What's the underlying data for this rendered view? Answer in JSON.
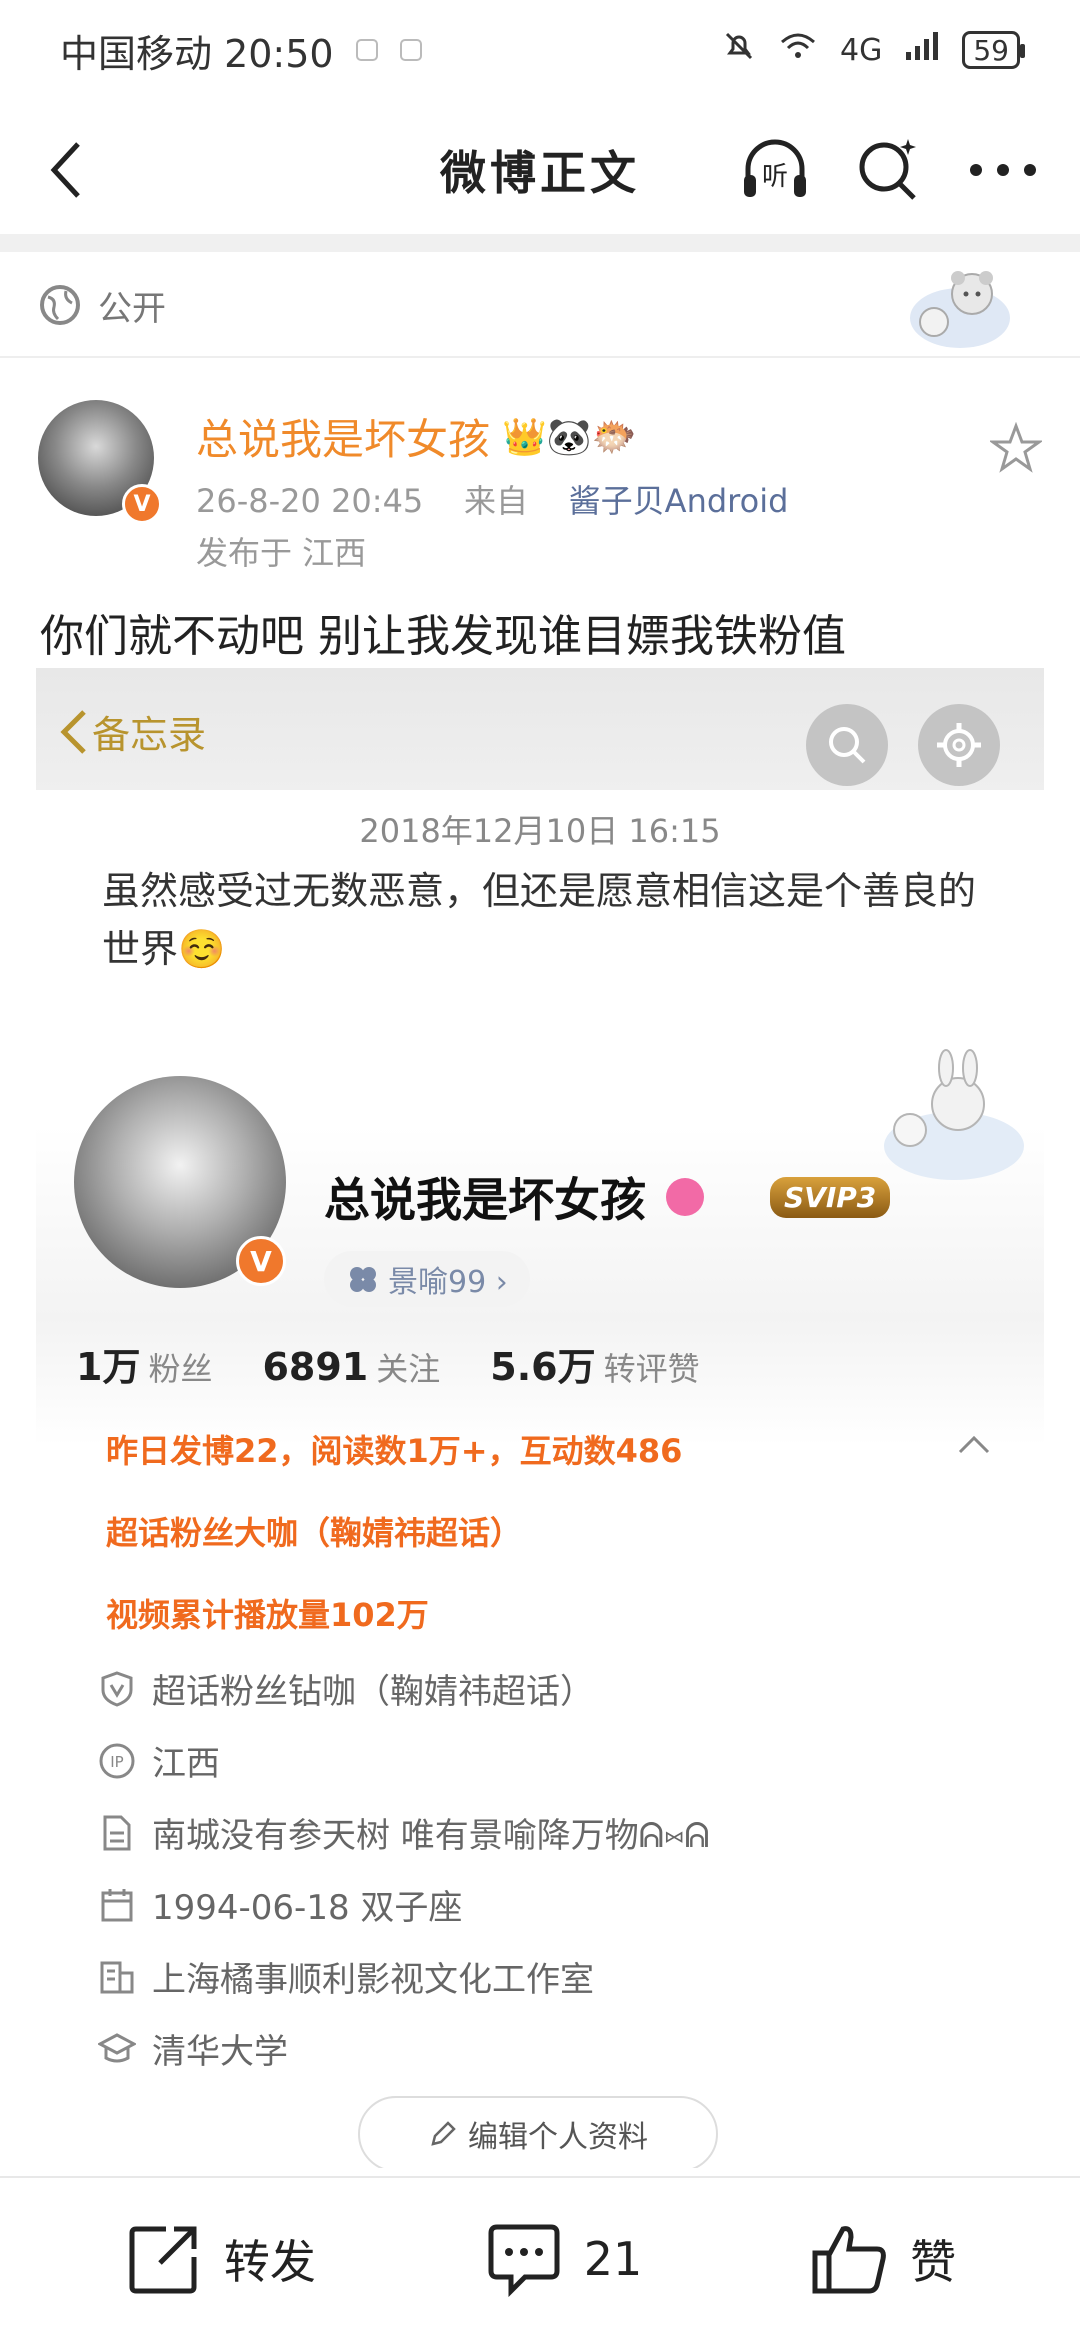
{
  "status_bar": {
    "carrier_time": "中国移动 20:50",
    "network": "4G",
    "battery": "59"
  },
  "nav": {
    "title": "微博正文",
    "listen_label": "听"
  },
  "visibility": {
    "label": "公开"
  },
  "post": {
    "author": "总说我是坏女孩",
    "author_emojis": "👑🐼🐡",
    "date": "26-8-20 20:45",
    "from_prefix": "来自",
    "source": "酱子贝Android",
    "location": "发布于 江西",
    "text": "你们就不动吧 别让我发现谁目嫖我铁粉值"
  },
  "memo": {
    "back_label": "备忘录",
    "date": "2018年12月10日 16:15",
    "text": "虽然感受过无数恶意，但还是愿意相信这是个善良的世界☺️"
  },
  "profile": {
    "name": "总说我是坏女孩",
    "svip": "SVIP3",
    "fan_tag": "景喻99 ›",
    "stats": [
      {
        "num": "1万",
        "label": "粉丝"
      },
      {
        "num": "6891",
        "label": "关注"
      },
      {
        "num": "5.6万",
        "label": "转评赞"
      }
    ],
    "highlights": [
      "昨日发博22，阅读数1万+，互动数486",
      "超话粉丝大咖（鞠婧祎超话）",
      "视频累计播放量102万"
    ],
    "info": [
      {
        "icon": "shield-v-icon",
        "text": "超话粉丝钻咖（鞠婧祎超话）"
      },
      {
        "icon": "ip-icon",
        "text": "江西"
      },
      {
        "icon": "document-icon",
        "text": "南城没有参天树 唯有景喻降万物ᕱ⑅︎ᕱ"
      },
      {
        "icon": "calendar-icon",
        "text": "1994-06-18 双子座"
      },
      {
        "icon": "company-icon",
        "text": "上海橘事顺利影视文化工作室"
      },
      {
        "icon": "school-icon",
        "text": "清华大学"
      }
    ],
    "edit_label": "编辑个人资料"
  },
  "actions": {
    "repost": "转发",
    "comment_count": "21",
    "like": "赞"
  },
  "colors": {
    "accent_orange": "#f06a1e",
    "name_orange": "#f08a2a",
    "source_blue": "#5b6f9a"
  }
}
